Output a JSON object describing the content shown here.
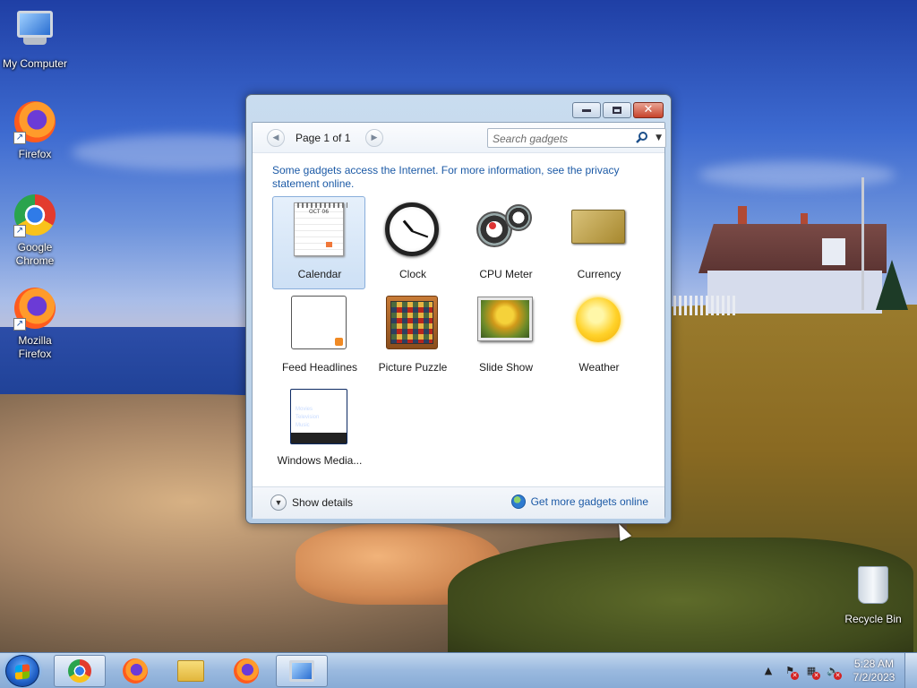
{
  "desktop": {
    "icons": [
      {
        "label": "My Computer",
        "icon": "computer-icon"
      },
      {
        "label": "Firefox",
        "icon": "firefox-icon"
      },
      {
        "label": "Google Chrome",
        "icon": "chrome-icon"
      },
      {
        "label": "Mozilla Firefox",
        "icon": "firefox-icon"
      },
      {
        "label": "Recycle Bin",
        "icon": "recycle-bin-icon"
      }
    ]
  },
  "gadget_window": {
    "page_label": "Page 1 of 1",
    "search_placeholder": "Search gadgets",
    "info_text": "Some gadgets access the Internet.  For more information, see the privacy statement online.",
    "gadgets": [
      {
        "label": "Calendar",
        "selected": true
      },
      {
        "label": "Clock"
      },
      {
        "label": "CPU Meter"
      },
      {
        "label": "Currency"
      },
      {
        "label": "Feed Headlines"
      },
      {
        "label": "Picture Puzzle"
      },
      {
        "label": "Slide Show"
      },
      {
        "label": "Weather"
      },
      {
        "label": "Windows Media..."
      }
    ],
    "calendar_month": "OCT 06",
    "wmc_lines": [
      "Movies",
      "Television",
      "Music"
    ],
    "show_details_label": "Show details",
    "get_more_label": "Get more gadgets online"
  },
  "taskbar": {
    "apps": [
      "chrome-icon",
      "firefox-icon",
      "file-explorer-icon",
      "firefox-icon",
      "gadget-gallery-icon"
    ],
    "tray": {
      "time": "5:28 AM",
      "date": "7/2/2023"
    }
  },
  "colors": {
    "link": "#1c5aa6",
    "selection": "#cde0f5",
    "close_button": "#c7432b"
  }
}
